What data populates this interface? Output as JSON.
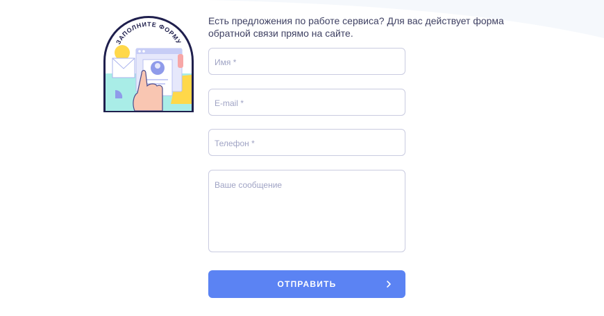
{
  "badge": {
    "text": "ЗАПОЛНИТЕ ФОРМУ"
  },
  "intro": {
    "text": "Есть предложения по работе сервиса? Для вас действует форма обратной связи прямо на сайте."
  },
  "form": {
    "name_placeholder": "Имя *",
    "email_placeholder": "E-mail *",
    "phone_placeholder": "Телефон *",
    "message_placeholder": "Ваше сообщение",
    "submit_label": "ОТПРАВИТЬ"
  },
  "colors": {
    "accent": "#5b83f3",
    "field_border": "#c9cbe0",
    "placeholder": "#9fa3c4",
    "text": "#3f4163",
    "badge_outline": "#1f1f4d"
  },
  "icons": {
    "submit": "chevron-right-icon",
    "badge": "fill-form-illustration"
  }
}
